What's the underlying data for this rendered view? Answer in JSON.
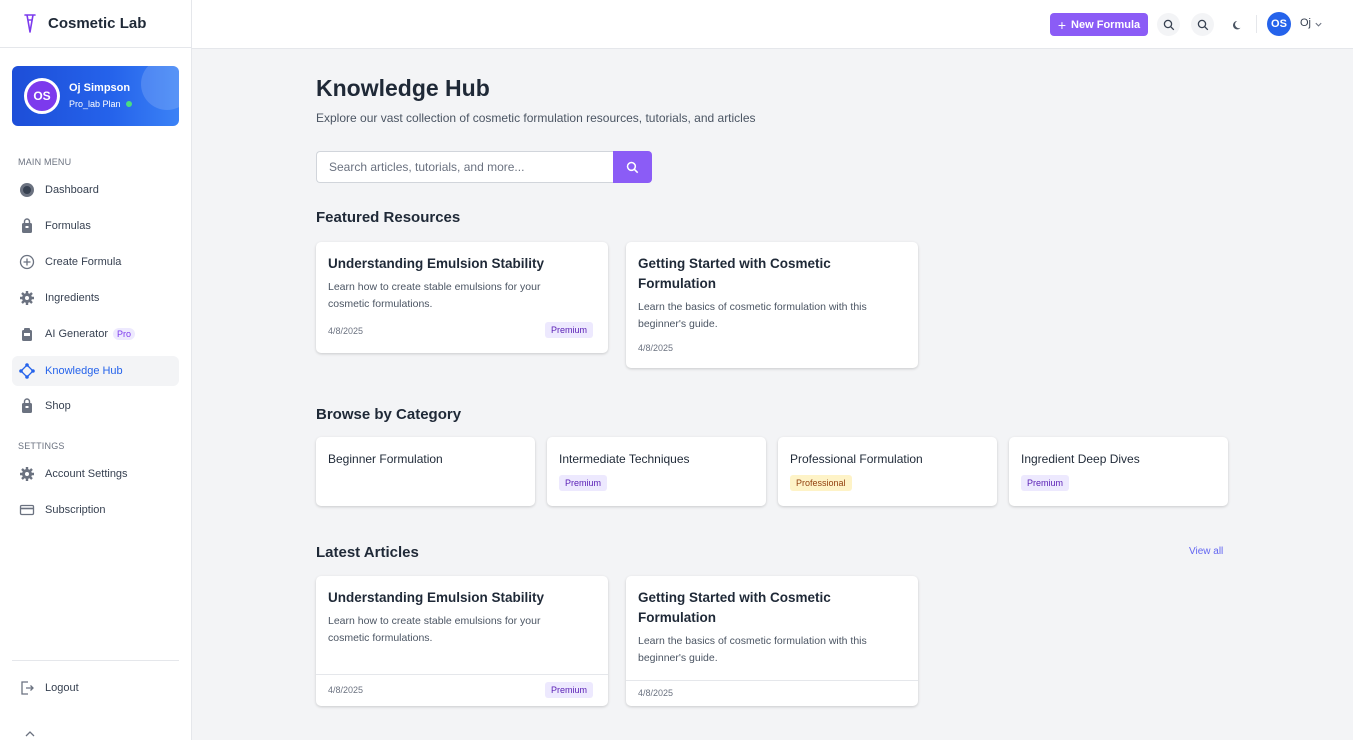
{
  "app": {
    "brand": "Cosmetic Lab"
  },
  "profile": {
    "initials": "OS",
    "name": "Oj Simpson",
    "plan": "Pro_lab Plan"
  },
  "sidebar": {
    "main_menu_label": "MAIN MENU",
    "main_items": [
      {
        "label": "Dashboard",
        "icon": "dashboard-icon"
      },
      {
        "label": "Formulas",
        "icon": "bag-icon"
      },
      {
        "label": "Create Formula",
        "icon": "plus-circle-icon"
      },
      {
        "label": "Ingredients",
        "icon": "gear-icon"
      },
      {
        "label": "AI Generator",
        "icon": "robot-icon",
        "badge": "Pro"
      },
      {
        "label": "Knowledge Hub",
        "icon": "hub-icon",
        "active": true
      },
      {
        "label": "Shop",
        "icon": "bag-icon"
      }
    ],
    "settings_label": "SETTINGS",
    "settings_items": [
      {
        "label": "Account Settings",
        "icon": "gear-icon"
      },
      {
        "label": "Subscription",
        "icon": "card-icon"
      }
    ],
    "logout_label": "Logout"
  },
  "topbar": {
    "new_formula_label": "New Formula",
    "user_initials": "OS",
    "user_name": "Oj"
  },
  "main": {
    "title": "Knowledge Hub",
    "subtitle": "Explore our vast collection of cosmetic formulation resources, tutorials, and articles",
    "search_placeholder": "Search articles, tutorials, and more...",
    "featured_heading": "Featured Resources",
    "featured": [
      {
        "title": "Understanding Emulsion Stability",
        "desc": "Learn how to create stable emulsions for your cosmetic formulations.",
        "date": "4/8/2025",
        "badge": "Premium"
      },
      {
        "title": "Getting Started with Cosmetic Formulation",
        "desc": "Learn the basics of cosmetic formulation with this beginner's guide.",
        "date": "4/8/2025"
      }
    ],
    "category_heading": "Browse by Category",
    "categories": [
      {
        "title": "Beginner Formulation"
      },
      {
        "title": "Intermediate Techniques",
        "badge": "Premium"
      },
      {
        "title": "Professional Formulation",
        "badge": "Professional"
      },
      {
        "title": "Ingredient Deep Dives",
        "badge": "Premium"
      }
    ],
    "latest_heading": "Latest Articles",
    "view_all_label": "View all",
    "latest": [
      {
        "title": "Understanding Emulsion Stability",
        "desc": "Learn how to create stable emulsions for your cosmetic formulations.",
        "date": "4/8/2025",
        "badge": "Premium"
      },
      {
        "title": "Getting Started with Cosmetic Formulation",
        "desc": "Learn the basics of cosmetic formulation with this beginner's guide.",
        "date": "4/8/2025"
      }
    ]
  },
  "colors": {
    "accent": "#8b5cf6",
    "primary_blue": "#2563eb",
    "active_text": "#2563eb",
    "premium_badge_bg": "#ede9fe",
    "professional_badge_bg": "#fef3c7"
  }
}
